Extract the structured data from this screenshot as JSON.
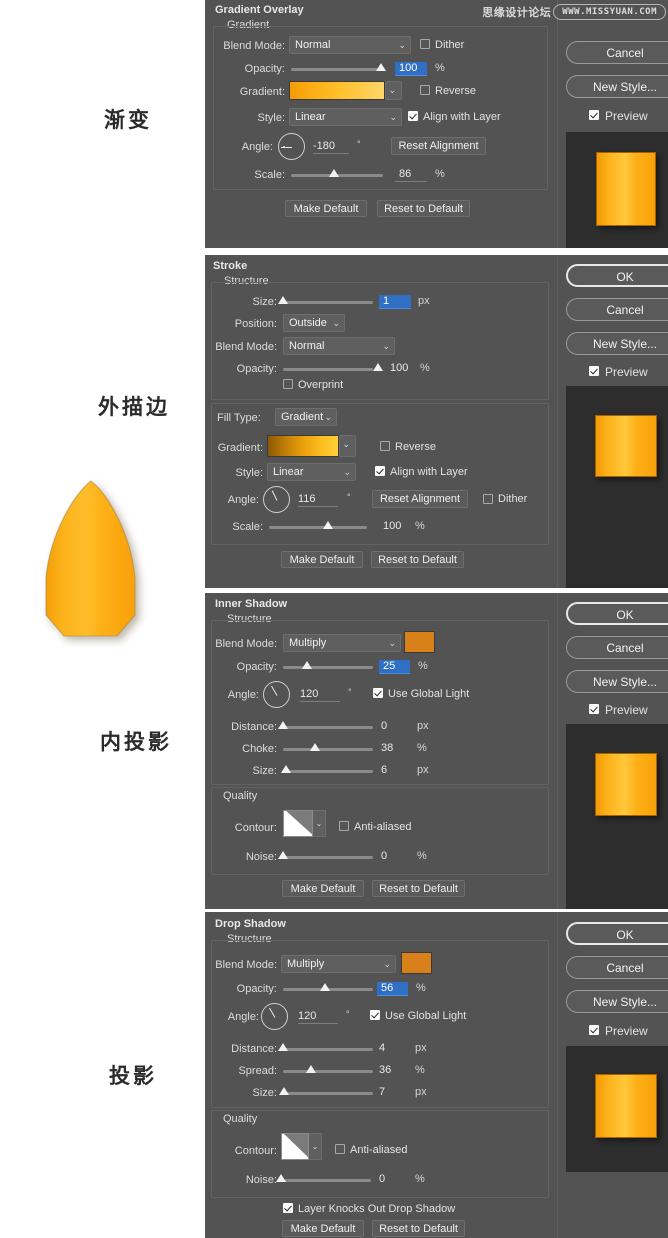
{
  "watermark": {
    "cn": "思缘设计论坛",
    "url": "WWW.MISSYUAN.COM"
  },
  "annotations": [
    {
      "label": "渐变",
      "meaning": "gradient"
    },
    {
      "label": "外描边",
      "meaning": "outer-stroke"
    },
    {
      "label": "内投影",
      "meaning": "inner-shadow"
    },
    {
      "label": "投影",
      "meaning": "drop-shadow"
    }
  ],
  "artwork": {
    "name": "orange-leaf-shape",
    "fill_start": "#FFB310",
    "fill_end": "#F9A207",
    "stroke": "#8a5a00"
  },
  "sidebar": {
    "ok": "OK",
    "cancel": "Cancel",
    "new_style": "New Style...",
    "preview": "Preview",
    "preview_checked": true
  },
  "panels": [
    {
      "id": "gradient-overlay",
      "title": "Gradient Overlay",
      "subtitle": "Gradient",
      "rows": {
        "blend_mode_label": "Blend Mode:",
        "blend_mode_value": "Normal",
        "dither_label": "Dither",
        "dither_checked": false,
        "opacity_label": "Opacity:",
        "opacity_value": "100",
        "opacity_unit": "%",
        "opacity_selected": true,
        "gradient_label": "Gradient:",
        "reverse_label": "Reverse",
        "reverse_checked": false,
        "style_label": "Style:",
        "style_value": "Linear",
        "align_label": "Align with Layer",
        "align_checked": true,
        "angle_label": "Angle:",
        "angle_value": "-180",
        "angle_unit": "°",
        "reset_alignment": "Reset Alignment",
        "scale_label": "Scale:",
        "scale_value": "86",
        "scale_unit": "%"
      },
      "footer": {
        "make_default": "Make Default",
        "reset_default": "Reset to Default"
      },
      "has_ok": false
    },
    {
      "id": "stroke",
      "title": "Stroke",
      "subtitle": "Structure",
      "rows": {
        "size_label": "Size:",
        "size_value": "1",
        "size_unit": "px",
        "size_selected": true,
        "position_label": "Position:",
        "position_value": "Outside",
        "blend_mode_label": "Blend Mode:",
        "blend_mode_value": "Normal",
        "opacity_label": "Opacity:",
        "opacity_value": "100",
        "opacity_unit": "%",
        "overprint_label": "Overprint",
        "overprint_checked": false,
        "fill_type_label": "Fill Type:",
        "fill_type_value": "Gradient",
        "gradient_label": "Gradient:",
        "reverse_label": "Reverse",
        "reverse_checked": false,
        "style_label": "Style:",
        "style_value": "Linear",
        "align_label": "Align with Layer",
        "align_checked": true,
        "angle_label": "Angle:",
        "angle_value": "116",
        "angle_unit": "°",
        "reset_alignment": "Reset Alignment",
        "dither_label": "Dither",
        "dither_checked": false,
        "scale_label": "Scale:",
        "scale_value": "100",
        "scale_unit": "%"
      },
      "footer": {
        "make_default": "Make Default",
        "reset_default": "Reset to Default"
      },
      "has_ok": true
    },
    {
      "id": "inner-shadow",
      "title": "Inner Shadow",
      "subtitle": "Structure",
      "quality_title": "Quality",
      "rows": {
        "blend_mode_label": "Blend Mode:",
        "blend_mode_value": "Multiply",
        "color": "#D8811A",
        "opacity_label": "Opacity:",
        "opacity_value": "25",
        "opacity_unit": "%",
        "opacity_selected": true,
        "angle_label": "Angle:",
        "angle_value": "120",
        "angle_unit": "°",
        "global_light_label": "Use Global Light",
        "global_light_checked": true,
        "distance_label": "Distance:",
        "distance_value": "0",
        "distance_unit": "px",
        "choke_label": "Choke:",
        "choke_value": "38",
        "choke_unit": "%",
        "size_label": "Size:",
        "size_value": "6",
        "size_unit": "px",
        "contour_label": "Contour:",
        "antialiased_label": "Anti-aliased",
        "antialiased_checked": false,
        "noise_label": "Noise:",
        "noise_value": "0",
        "noise_unit": "%"
      },
      "footer": {
        "make_default": "Make Default",
        "reset_default": "Reset to Default"
      },
      "has_ok": true
    },
    {
      "id": "drop-shadow",
      "title": "Drop Shadow",
      "subtitle": "Structure",
      "quality_title": "Quality",
      "rows": {
        "blend_mode_label": "Blend Mode:",
        "blend_mode_value": "Multiply",
        "color": "#D8811A",
        "opacity_label": "Opacity:",
        "opacity_value": "56",
        "opacity_unit": "%",
        "opacity_selected": true,
        "angle_label": "Angle:",
        "angle_value": "120",
        "angle_unit": "°",
        "global_light_label": "Use Global Light",
        "global_light_checked": true,
        "distance_label": "Distance:",
        "distance_value": "4",
        "distance_unit": "px",
        "spread_label": "Spread:",
        "spread_value": "36",
        "spread_unit": "%",
        "size_label": "Size:",
        "size_value": "7",
        "size_unit": "px",
        "contour_label": "Contour:",
        "antialiased_label": "Anti-aliased",
        "antialiased_checked": false,
        "noise_label": "Noise:",
        "noise_value": "0",
        "noise_unit": "%",
        "knockout_label": "Layer Knocks Out Drop Shadow",
        "knockout_checked": true
      },
      "footer": {
        "make_default": "Make Default",
        "reset_default": "Reset to Default"
      },
      "has_ok": true
    }
  ]
}
